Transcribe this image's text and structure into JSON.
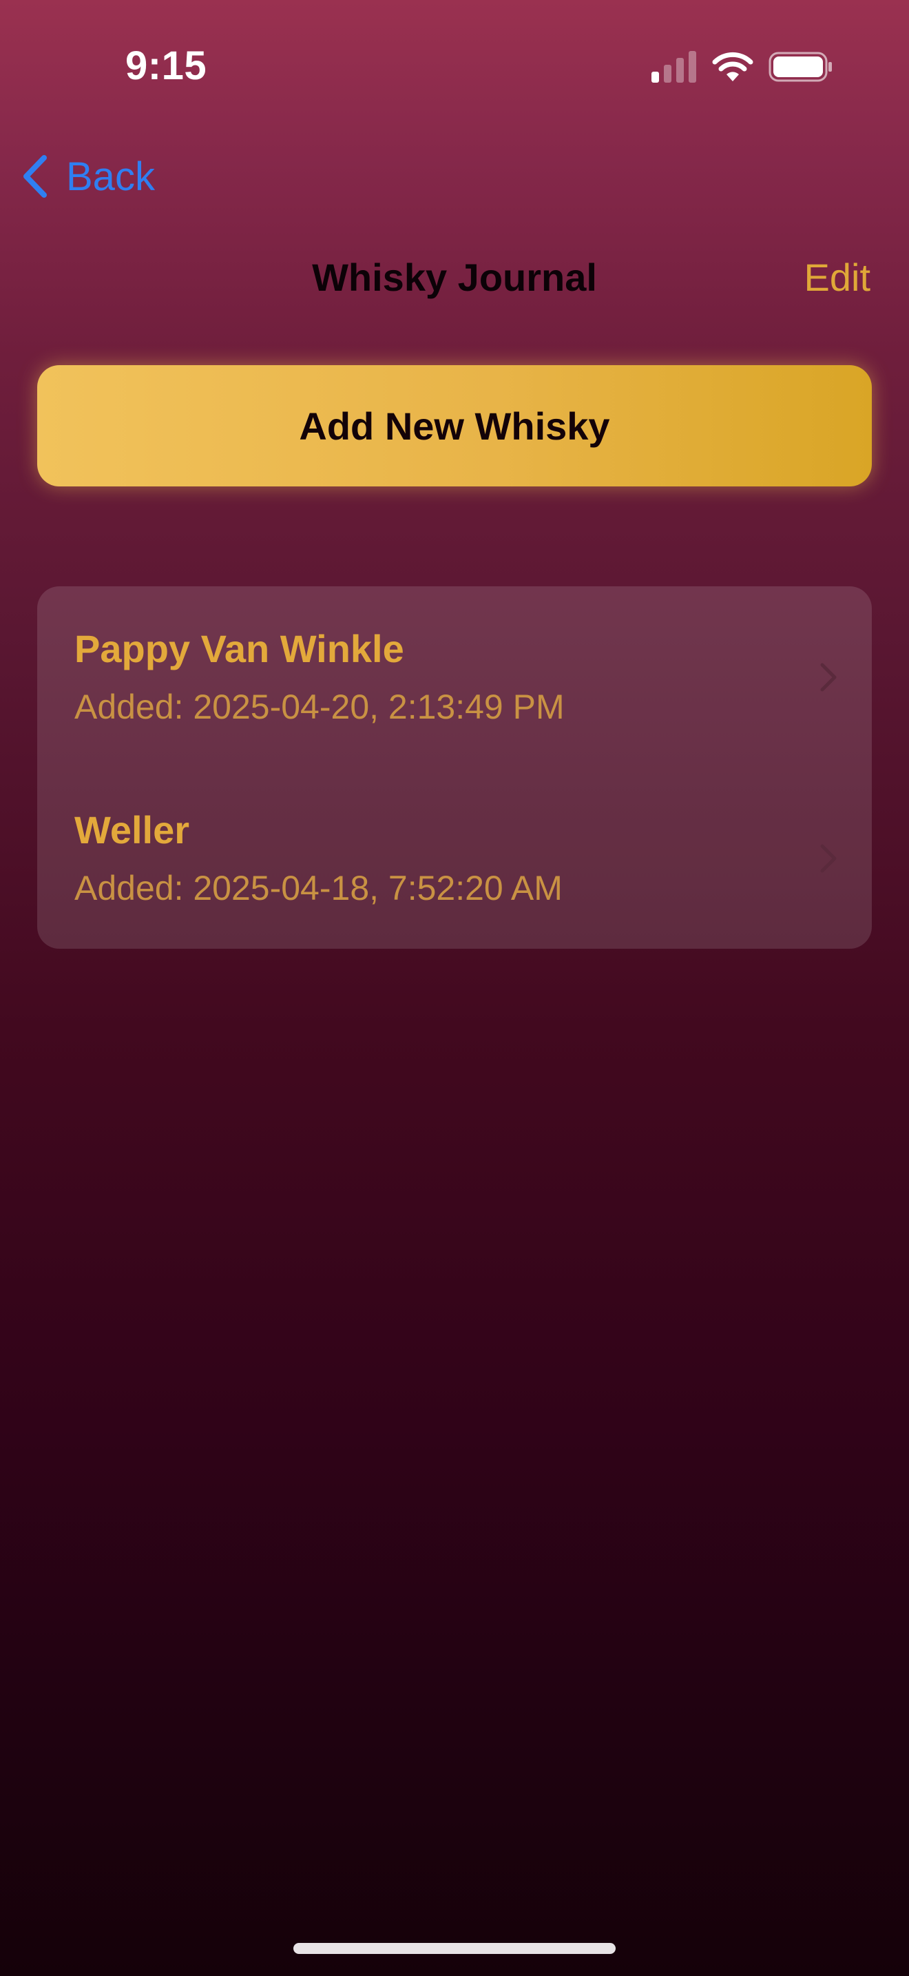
{
  "status_bar": {
    "time": "9:15"
  },
  "nav": {
    "back_label": "Back",
    "title": "Whisky Journal",
    "edit_label": "Edit"
  },
  "actions": {
    "add_label": "Add New Whisky"
  },
  "whiskies": [
    {
      "name": "Pappy Van Winkle",
      "added": "Added: 2025-04-20, 2:13:49 PM"
    },
    {
      "name": "Weller",
      "added": "Added: 2025-04-18, 7:52:20 AM"
    }
  ],
  "colors": {
    "accent_gold": "#e3a93b",
    "link_blue": "#2f7ff2",
    "button_gradient_start": "#f1c25b",
    "button_gradient_end": "#d9a526"
  }
}
